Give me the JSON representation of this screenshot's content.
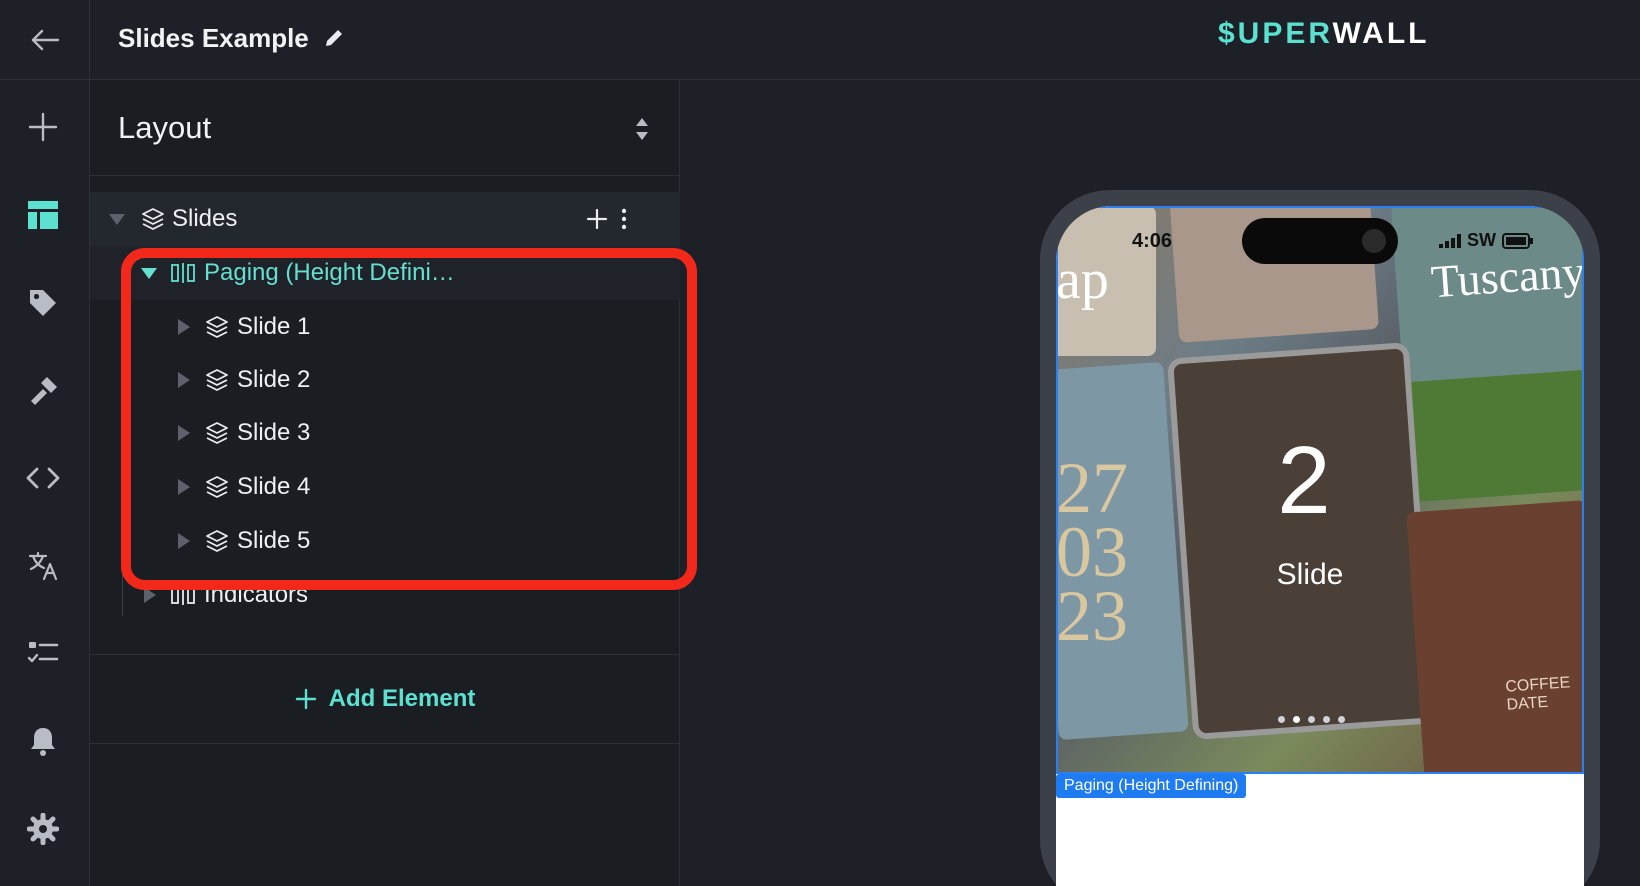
{
  "header": {
    "title": "Slides Example",
    "brand_accent": "$UPER",
    "brand_rest": "WALL"
  },
  "rail": {
    "items": [
      "back-icon",
      "plus-icon",
      "layout-icon",
      "tag-icon",
      "hammer-icon",
      "code-icon",
      "translate-icon",
      "checklist-icon",
      "bell-icon",
      "gear-icon"
    ],
    "active": "layout-icon"
  },
  "panel": {
    "heading": "Layout",
    "tree": {
      "root": "Slides",
      "paging": "Paging (Height Defini…",
      "slides": [
        "Slide 1",
        "Slide 2",
        "Slide 3",
        "Slide 4",
        "Slide 5"
      ],
      "indicators": "Indicators"
    },
    "add_element": "Add Element"
  },
  "preview": {
    "time": "4:06",
    "carrier": "SW",
    "slide_number": "2",
    "slide_label": "Slide",
    "tuscany": "Tuscany",
    "coffee": "COFFEE DATE",
    "selection_label": "Paging (Height Defining)",
    "page_dots": 5,
    "active_dot": 2
  },
  "colors": {
    "accent": "#5ce0d0",
    "highlight": "#f2291a",
    "selection": "#1f7bf2",
    "background": "#1d2026"
  }
}
